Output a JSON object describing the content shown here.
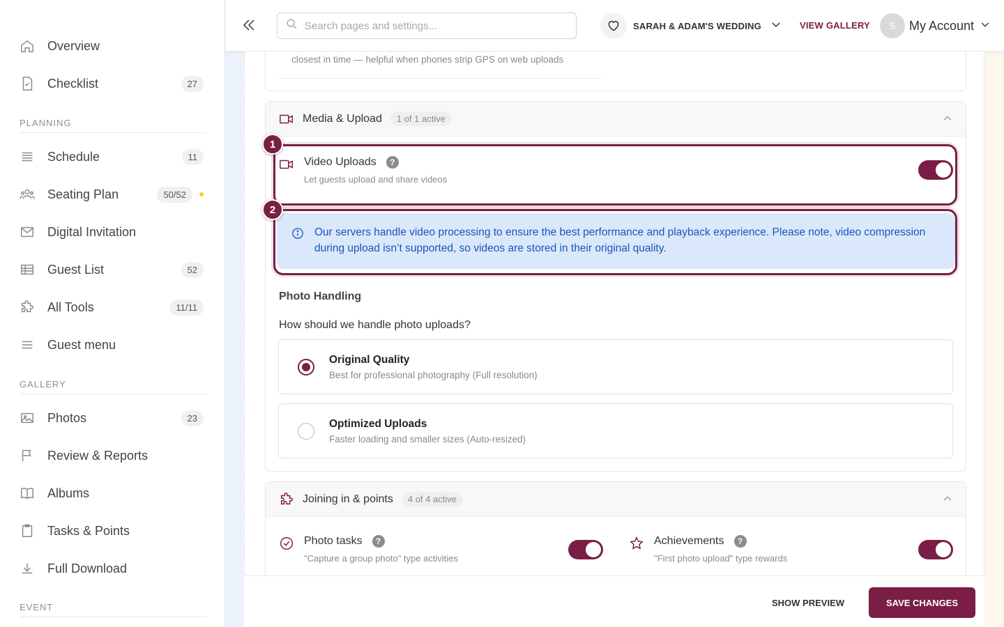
{
  "sidebar": {
    "nav": [
      {
        "label": "Overview",
        "icon": "home-icon"
      },
      {
        "label": "Checklist",
        "icon": "checklist-icon",
        "badge": "27"
      }
    ],
    "sections": [
      {
        "label": "PLANNING",
        "items": [
          {
            "label": "Schedule",
            "icon": "schedule-icon",
            "badge": "11"
          },
          {
            "label": "Seating Plan",
            "icon": "seating-icon",
            "badge": "50/52",
            "dot": true
          },
          {
            "label": "Digital Invitation",
            "icon": "mail-icon"
          },
          {
            "label": "Guest List",
            "icon": "table-icon",
            "badge": "52"
          },
          {
            "label": "All Tools",
            "icon": "puzzle-icon",
            "badge": "11/11"
          },
          {
            "label": "Guest menu",
            "icon": "menu-icon"
          }
        ]
      },
      {
        "label": "GALLERY",
        "items": [
          {
            "label": "Photos",
            "icon": "image-icon",
            "badge": "23"
          },
          {
            "label": "Review & Reports",
            "icon": "flag-icon"
          },
          {
            "label": "Albums",
            "icon": "book-icon"
          },
          {
            "label": "Tasks & Points",
            "icon": "clipboard-icon"
          },
          {
            "label": "Full Download",
            "icon": "download-icon"
          }
        ]
      },
      {
        "label": "EVENT",
        "items": []
      }
    ]
  },
  "header": {
    "search_placeholder": "Search pages and settings...",
    "wedding_name": "SARAH & ADAM'S WEDDING",
    "view_gallery": "VIEW GALLERY",
    "avatar_initial": "S",
    "account_label": "My Account"
  },
  "main": {
    "prev_card_desc": "closest in time — helpful when phones strip GPS on web uploads",
    "media_section": {
      "title": "Media & Upload",
      "count": "1 of 1 active",
      "video_uploads": {
        "title": "Video Uploads",
        "help": "?",
        "desc": "Let guests upload and share videos",
        "enabled": true
      },
      "info_text": "Our servers handle video processing to ensure the best performance and playback experience. Please note, video compression during upload isn’t supported, so videos are stored in their original quality.",
      "photo_heading": "Photo Handling",
      "photo_question": "How should we handle photo uploads?",
      "options": [
        {
          "title": "Original Quality",
          "desc": "Best for professional photography (Full resolution)",
          "selected": true
        },
        {
          "title": "Optimized Uploads",
          "desc": "Faster loading and smaller sizes (Auto-resized)",
          "selected": false
        }
      ]
    },
    "joining_section": {
      "title": "Joining in & points",
      "count": "4 of 4 active",
      "items": [
        {
          "title": "Photo tasks",
          "help": "?",
          "desc": "\"Capture a group photo\" type activities",
          "enabled": true
        },
        {
          "title": "Achievements",
          "help": "?",
          "desc": "\"First photo upload\" type rewards",
          "enabled": true
        }
      ]
    },
    "markers": [
      "1",
      "2"
    ]
  },
  "footer": {
    "preview_label": "SHOW PREVIEW",
    "save_label": "SAVE CHANGES"
  },
  "colors": {
    "accent": "#7a1e45",
    "info_bg": "#dbe8fb",
    "info_text": "#1a55b8"
  }
}
